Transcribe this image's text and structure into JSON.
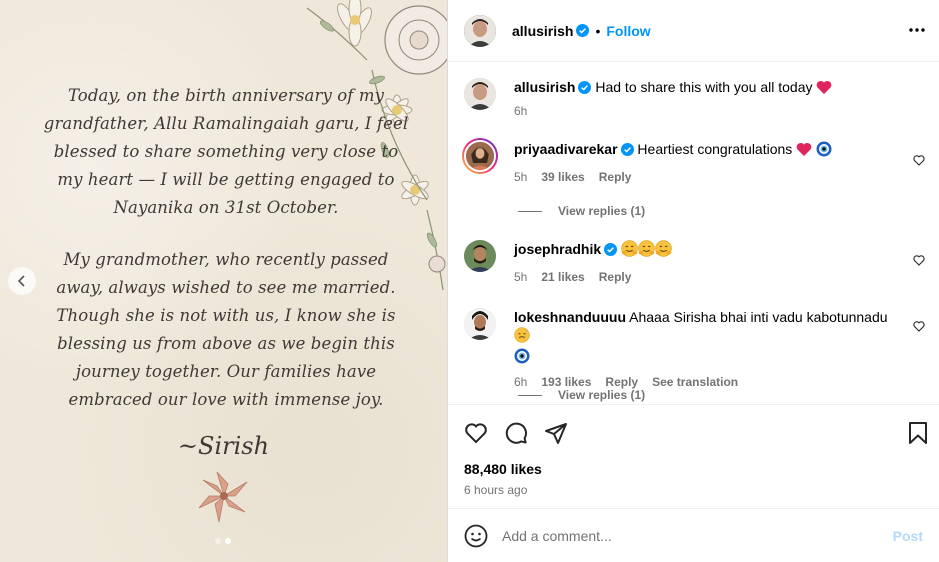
{
  "post": {
    "letter_para1": "Today, on the birth anniversary of my grandfather, Allu Ramalingaiah garu, I feel blessed to share something very close to my heart — I will be getting engaged to Nayanika on 31st October.",
    "letter_para2": "My grandmother, who recently passed away, always wished to see me married. Though she is not with us, I know she is blessing us from above as we begin this journey together. Our families have embraced our love with immense joy.",
    "signature": "~Sirish",
    "carousel_count": 2,
    "carousel_active": 2
  },
  "header": {
    "username": "allusirish",
    "separator": "•",
    "follow_label": "Follow"
  },
  "caption": {
    "username": "allusirish",
    "text": "Had to share this with you all today",
    "time": "6h"
  },
  "comments": [
    {
      "username": "priyaadivarekar",
      "verified": true,
      "text": "Heartiest congratulations",
      "time": "5h",
      "likes": "39 likes",
      "reply_label": "Reply",
      "view_replies": "View replies (1)"
    },
    {
      "username": "josephradhik",
      "verified": true,
      "text": "",
      "time": "5h",
      "likes": "21 likes",
      "reply_label": "Reply"
    },
    {
      "username": "lokeshnanduuuu",
      "verified": false,
      "text": "Ahaaa Sirisha bhai inti vadu kabotunnadu",
      "time": "6h",
      "likes": "193 likes",
      "reply_label": "Reply",
      "translation_label": "See translation",
      "view_replies": "View replies (1)"
    }
  ],
  "actions": {
    "likes": "88,480 likes",
    "time_ago": "6 hours ago"
  },
  "add_comment": {
    "placeholder": "Add a comment...",
    "post_label": "Post"
  },
  "colors": {
    "link_blue": "#0095f6",
    "post_disabled": "#b3dbff",
    "muted_text": "#737373",
    "paper": "#efe8da",
    "verified_blue": "#0095f6"
  }
}
